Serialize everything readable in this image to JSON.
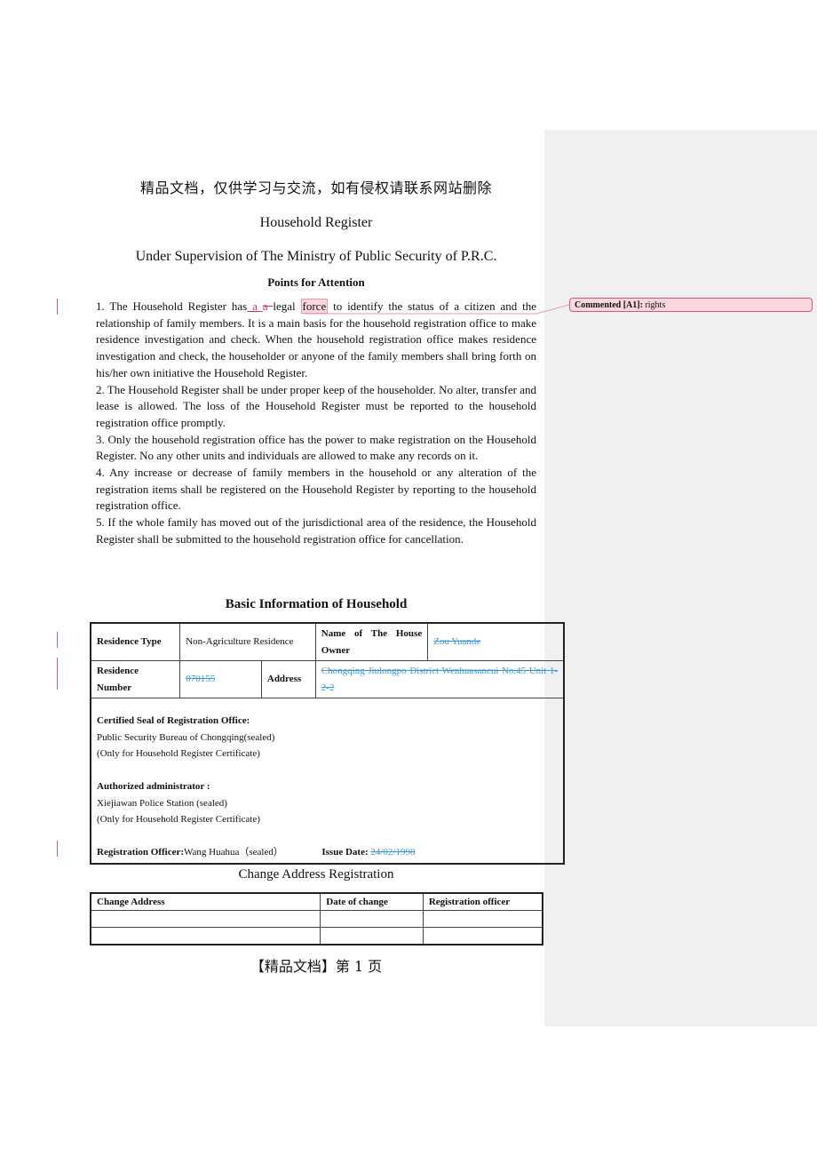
{
  "watermark": "精品文档，仅供学习与交流，如有侵权请联系网站删除",
  "title": "Household Register",
  "subtitle": "Under Supervision of The Ministry of Public Security of P.R.C.",
  "points_heading": "Points for Attention",
  "point1": {
    "before": "1. The Household Register has",
    "inserted": " a ",
    "deleted": "a ",
    "middle": "legal ",
    "highlighted": "force",
    "after": " to identify the status of a citizen and the relationship of family members. It is a main basis for the household registration office to make residence investigation and check. When the household registration office makes residence investigation and check, the householder or anyone of the family members shall bring forth on his/her own initiative the Household Register."
  },
  "points": [
    "2. The Household Register shall be under proper keep of the householder. No alter, transfer and lease is allowed. The loss of the Household Register must be reported to the household registration office promptly.",
    "3. Only the household registration office has the power to make registration on the Household Register. No any other units and individuals are allowed to make any records on it.",
    "4. Any increase or decrease of family members in the household or any alteration of the registration items shall be registered on the Household Register by reporting to the household registration office.",
    "5. If the whole family has moved out of the jurisdictional area of the residence, the Household Register shall be submitted to the household registration office for cancellation."
  ],
  "comment": {
    "label": "Commented [A1]:",
    "text": "rights"
  },
  "basic_info": {
    "heading": "Basic Information of Household",
    "residence_type_label": "Residence Type",
    "residence_type_value": "Non-Agriculture Residence",
    "owner_label": "Name of The House Owner",
    "owner_value": "Zou Yuande",
    "residence_number_label": "Residence Number",
    "residence_number_value": "070155",
    "address_label": "Address",
    "address_value": "Chongqing Jiulongpo District Wenhuasancui No.45 Unit 1-2-2",
    "seal_label": "Certified Seal of Registration Office:",
    "seal_line1": "Public Security Bureau of Chongqing(sealed)",
    "seal_line2": "(Only for Household Register Certificate)",
    "admin_label": "Authorized administrator :",
    "admin_line1": "Xiejiawan Police Station (sealed)",
    "admin_line2": "(Only for Household Register Certificate)",
    "officer_label": "Registration Officer:",
    "officer_value": "Wang Huahua（sealed）",
    "issue_label": "Issue Date:",
    "issue_value": "24/02/1998"
  },
  "change_address": {
    "heading": "Change Address Registration",
    "columns": [
      "Change Address",
      "Date of change",
      "Registration officer"
    ],
    "rows": [
      [
        "",
        "",
        ""
      ],
      [
        "",
        "",
        ""
      ]
    ]
  },
  "footer": "【精品文档】第 1 页",
  "colors": {
    "revision": "#c8365a",
    "tracked_change": "#3b9ad6",
    "comment_bg": "#fbd6de",
    "comment_pane": "#f0f0f0"
  }
}
